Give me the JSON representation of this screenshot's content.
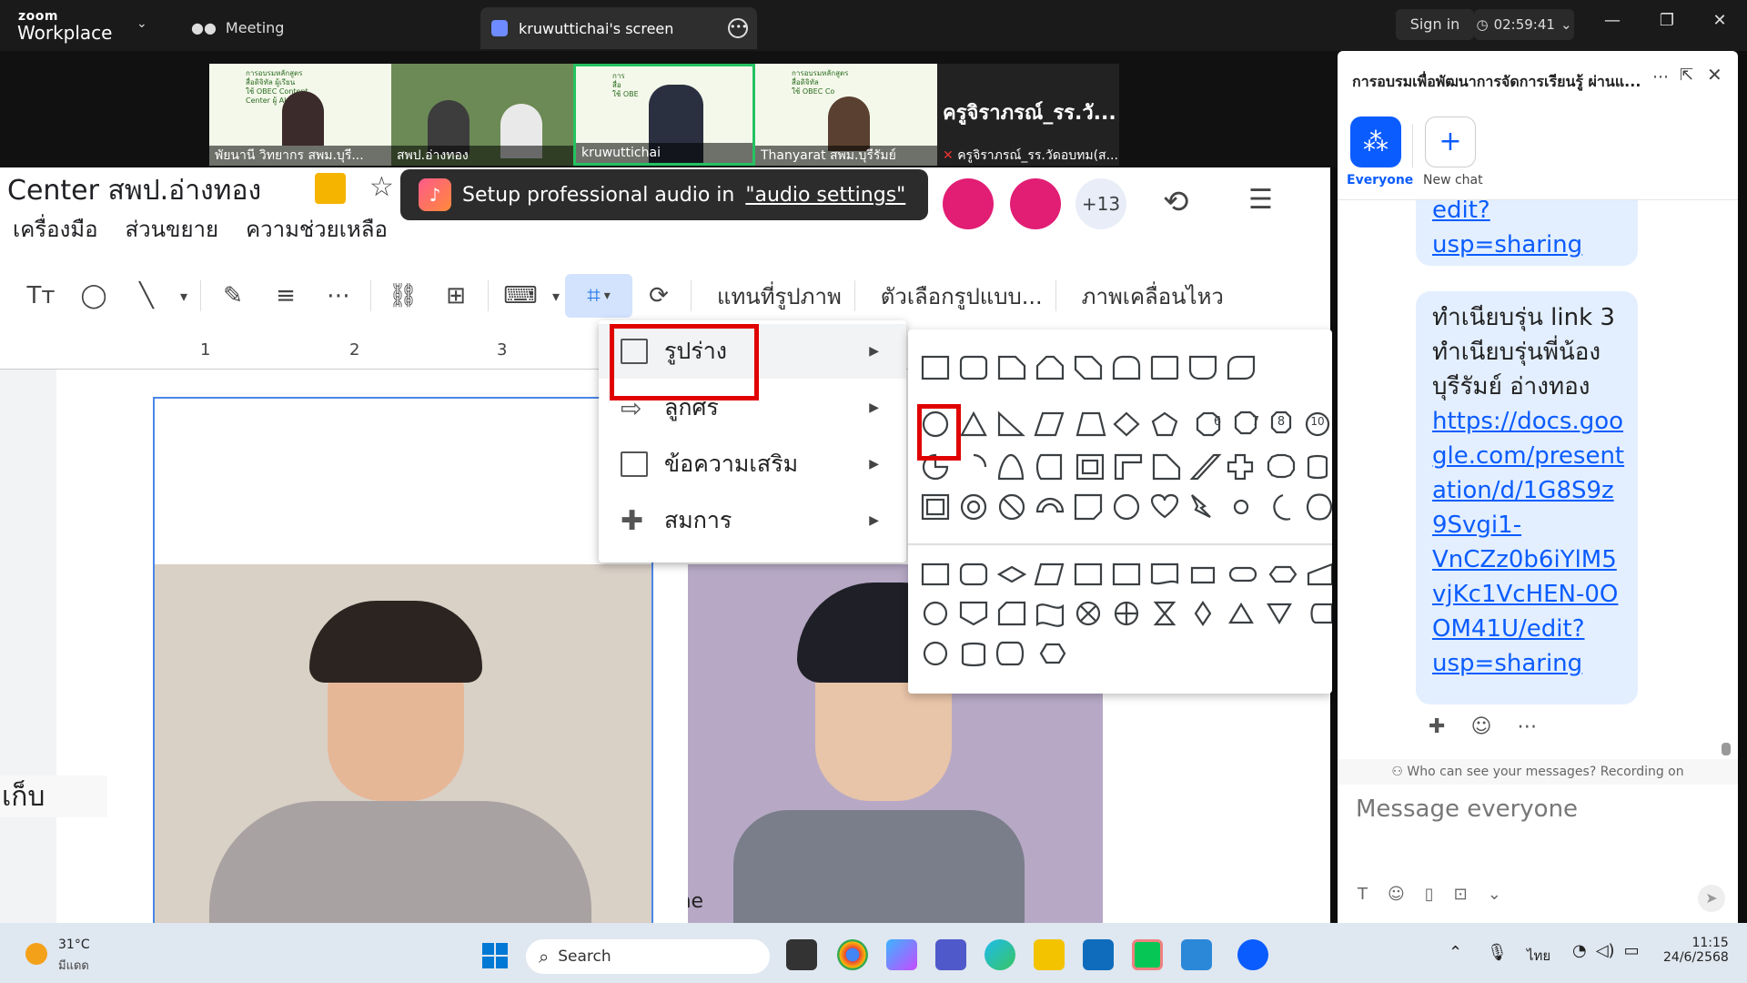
{
  "zoom": {
    "logo_top": "zoom",
    "logo_bottom": "Workplace",
    "meeting_label": "Meeting",
    "screen_tab_label": "kruwuttichai's screen",
    "sign_in": "Sign in",
    "timer": "02:59:41"
  },
  "participants": [
    {
      "name": "พัยนานี วิทยากร สพม.บุรี...",
      "color": "#cfe8b7"
    },
    {
      "name": "สพป.อ่างทอง",
      "color": "#6c8a55"
    },
    {
      "name": "kruwuttichai",
      "color": "#d8e6c2"
    },
    {
      "name": "Thanyarat สพม.บุรีรัมย์",
      "color": "#e4ecd6"
    },
    {
      "name": "ครูจิราภรณ์_รร.วัดอบทม(ส...",
      "big": "ครูจิราภรณ์_รร.วั..."
    }
  ],
  "slides": {
    "doc_title": "Center สพป.อ่างทอง",
    "menu": [
      "เครื่องมือ",
      "ส่วนขยาย",
      "ความช่วยเหลือ"
    ],
    "audio_toast": {
      "prefix": "Setup professional audio in",
      "link": "\"audio settings\""
    },
    "badge_count": "+13",
    "toolbar_texts": [
      "แทนที่รูปภาพ",
      "ตัวเลือกรูปแบบ...",
      "ภาพเคลื่อนไหว"
    ],
    "ruler_numbers": [
      "1",
      "2",
      "3"
    ],
    "left_text": "เก็บ",
    "photo2_text": "ache"
  },
  "crop_menu": {
    "items": [
      {
        "label": "รูปร่าง",
        "icon": "rectangle-icon"
      },
      {
        "label": "ลูกศร",
        "icon": "arrow-icon"
      },
      {
        "label": "ข้อความเสริม",
        "icon": "callout-icon"
      },
      {
        "label": "สมการ",
        "icon": "plus-icon"
      }
    ]
  },
  "shape_numbers": [
    "6",
    "7",
    "8",
    "10"
  ],
  "chat": {
    "title": "การอบรมเพื่อพัฒนาการจัดการเรียนรู้ ผ่านแ...",
    "tab_everyone": "Everyone",
    "tab_new": "New chat",
    "bubble1_links": [
      "edit?",
      "usp=sharing"
    ],
    "bubble2_lines": [
      "ทำเนียบรุ่น link 3",
      "ทำเนียบรุ่นพี่น้อง",
      "บุรีรัมย์ อ่างทอง"
    ],
    "bubble2_links": [
      "https://docs.goo",
      "gle.com/present",
      "ation/d/1G8S9z",
      "9Svgi1-",
      "VnCZz0b6iYlM5",
      "vjKc1VcHEN-0O",
      "OM41U/edit?",
      "usp=sharing"
    ],
    "who_can_see": "Who can see your messages? Recording on",
    "placeholder": "Message everyone"
  },
  "taskbar": {
    "temp": "31°C",
    "weather": "มีแดด",
    "search": "Search",
    "lang": "ไทย",
    "time": "11:15",
    "date": "24/6/2568"
  }
}
